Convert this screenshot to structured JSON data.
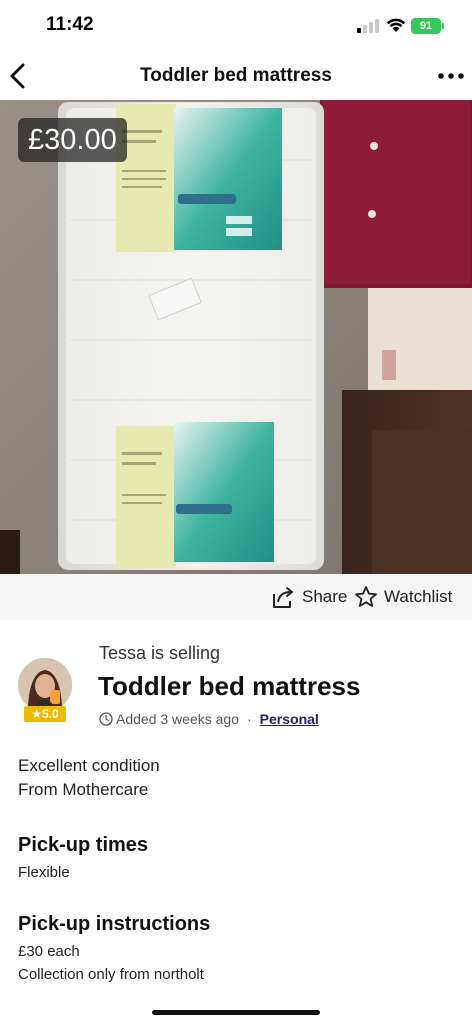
{
  "status_bar": {
    "time": "11:42",
    "battery": "91"
  },
  "nav": {
    "title": "Toddler bed mattress",
    "back_icon": "chevron-left-icon",
    "more_icon": "more-dots-icon"
  },
  "photo": {
    "price": "£30.00",
    "page_count": 2,
    "active_page": 1
  },
  "actions": {
    "share_label": "Share",
    "watchlist_label": "Watchlist"
  },
  "seller": {
    "selling_text": "Tessa is selling",
    "rating": "★5.0"
  },
  "listing": {
    "title": "Toddler bed mattress",
    "added": "Added 3 weeks ago",
    "separator": "·",
    "category": "Personal"
  },
  "description": {
    "line1": "Excellent condition",
    "line2": "From Mothercare"
  },
  "pickup_times": {
    "heading": "Pick-up times",
    "value": "Flexible"
  },
  "pickup_instructions": {
    "heading": "Pick-up instructions",
    "line1": "£30 each",
    "line2": "Collection only from northolt"
  },
  "colors": {
    "price_badge_bg": "#1e1e1e",
    "rating_badge": "#f1b800",
    "link": "#2a1b6b",
    "battery": "#34c759"
  }
}
